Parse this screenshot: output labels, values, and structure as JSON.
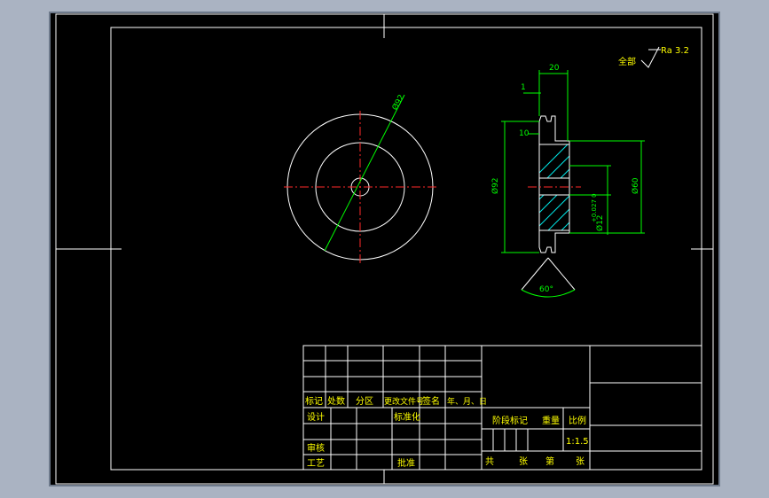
{
  "colors": {
    "background": "#000000",
    "outline": "#ffffff",
    "dimension": "#00ff00",
    "centerline": "#ff2a2a",
    "hatch": "#00e5e5",
    "text": "#ffff00"
  },
  "roughness": {
    "prefix": "全部",
    "value": "Ra 3.2"
  },
  "front_view": {
    "diameter_label": "Ø92"
  },
  "section_view": {
    "dim_width_top": "20",
    "dim_flange_thickness": "1",
    "dim_groove": "10",
    "dim_outer_diameter": "Ø92",
    "dim_hub_diameter": "Ø60",
    "dim_bore": "Ø12",
    "dim_bore_tol": "+0.027 0",
    "groove_angle": "60°"
  },
  "title_block": {
    "header": [
      "标记",
      "处数",
      "分区",
      "更改文件号",
      "签名",
      "年、月、日"
    ],
    "design": "设计",
    "standardize": "标准化",
    "review": "审核",
    "process": "工艺",
    "approve": "批准",
    "stage_mark": "阶段标记",
    "weight": "重量",
    "scale_label": "比例",
    "scale_value": "1:1.5",
    "sheets_total": "共",
    "sheets_unit": "张",
    "sheet_no": "第",
    "sheet_unit2": "张"
  }
}
